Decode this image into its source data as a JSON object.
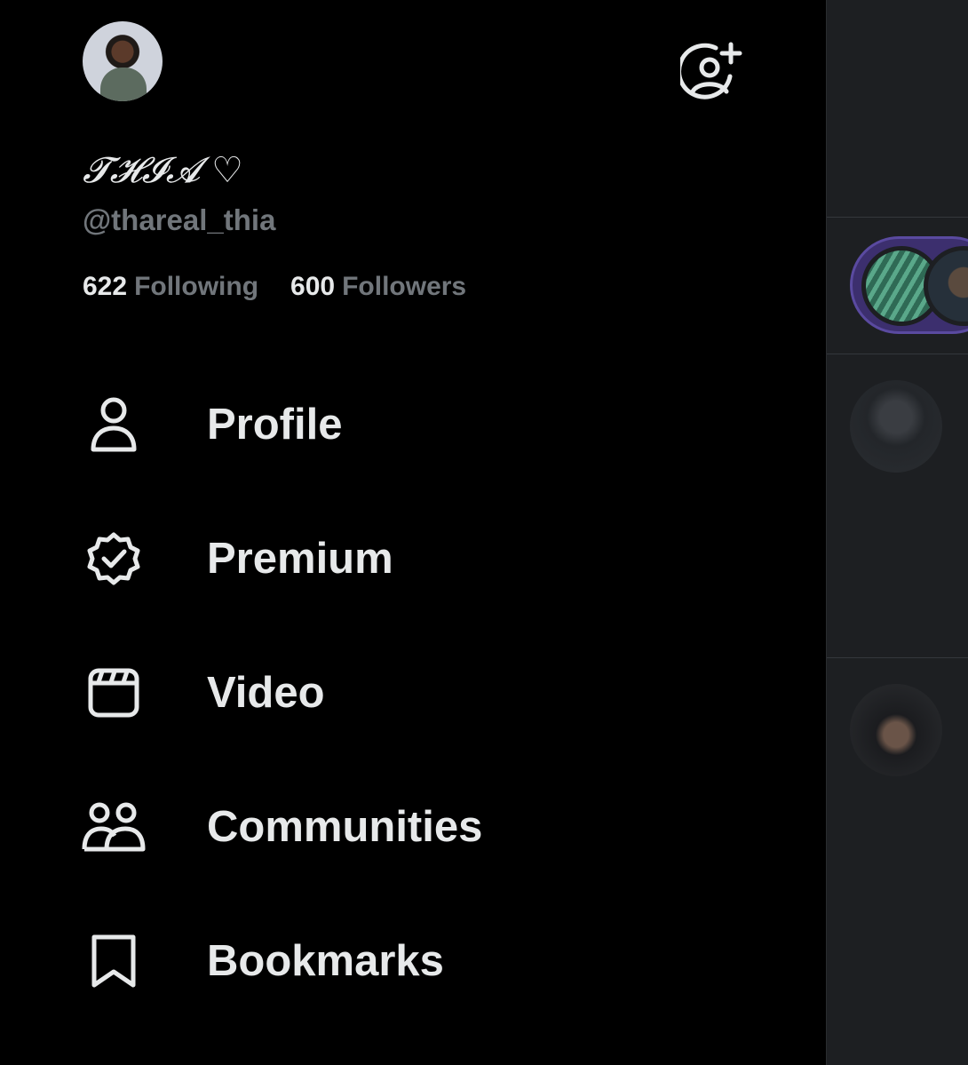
{
  "account": {
    "display_name": "𝓣𝓗𝓘𝓐 ♡",
    "handle": "@thareal_thia",
    "following_count": "622",
    "following_label": "Following",
    "followers_count": "600",
    "followers_label": "Followers",
    "add_account_icon": "add-account-icon",
    "avatar_icon": "avatar"
  },
  "menu": {
    "items": [
      {
        "label": "Profile",
        "icon": "person-icon"
      },
      {
        "label": "Premium",
        "icon": "verified-badge-icon"
      },
      {
        "label": "Video",
        "icon": "video-clapper-icon"
      },
      {
        "label": "Communities",
        "icon": "communities-icon"
      },
      {
        "label": "Bookmarks",
        "icon": "bookmark-icon"
      }
    ]
  },
  "colors": {
    "background": "#000000",
    "primary_text": "#e7e9ea",
    "secondary_text": "#71767b",
    "background_feed": "#1d1f22"
  }
}
